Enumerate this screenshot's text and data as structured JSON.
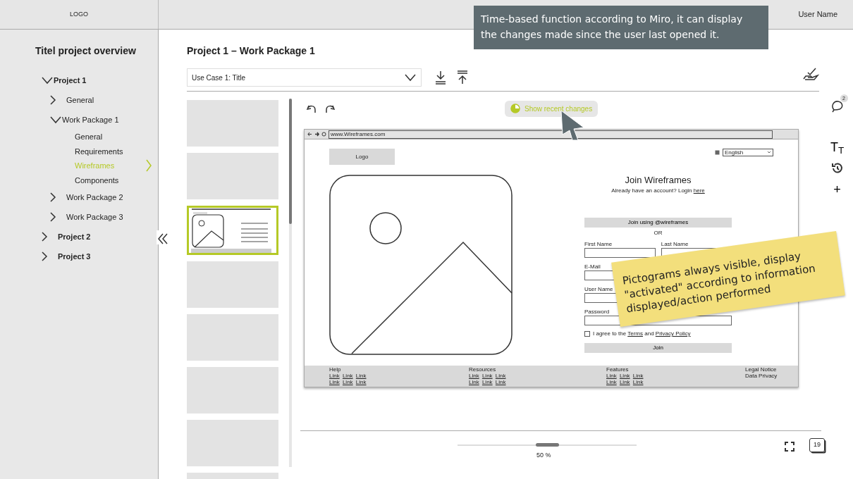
{
  "header": {
    "logo": "LOGO",
    "user_name": "User Name"
  },
  "notes": [
    {
      "kind": "tooltip",
      "text": "Time-based function according to Miro, it can display the changes made since the user last opened it."
    },
    {
      "kind": "sticky",
      "text": "Pictograms always visible, display \"activated\" according to information displayed/action performed"
    }
  ],
  "sidebar": {
    "title": "Titel project overview",
    "tree": [
      {
        "label": "Project 1",
        "expanded": true,
        "selected": false,
        "children": [
          {
            "label": "General",
            "expanded": false,
            "selected": false
          },
          {
            "label": "Work Package 1",
            "expanded": true,
            "selected": false,
            "children": [
              {
                "label": "General",
                "selected": false
              },
              {
                "label": "Requirements",
                "selected": false
              },
              {
                "label": "Wireframes",
                "selected": true
              },
              {
                "label": "Components",
                "selected": false
              }
            ]
          },
          {
            "label": "Work Package 2",
            "expanded": false,
            "selected": false
          },
          {
            "label": "Work Package 3",
            "expanded": false,
            "selected": false
          }
        ]
      },
      {
        "label": "Project 2",
        "expanded": false,
        "selected": false
      },
      {
        "label": "Project 3",
        "expanded": false,
        "selected": false
      }
    ]
  },
  "page_title": "Project 1 – Work Package 1",
  "use_case_select": {
    "value": "Use Case 1: Title"
  },
  "thumbnails": [
    {
      "selected": false
    },
    {
      "selected": false
    },
    {
      "selected": true
    },
    {
      "selected": false
    },
    {
      "selected": false
    },
    {
      "selected": false
    },
    {
      "selected": false
    },
    {
      "selected": false
    }
  ],
  "recent_changes_button": {
    "label": "Show recent changes"
  },
  "wireframe": {
    "url": "www.Wireframes.com",
    "logo": "Logo",
    "language": "English",
    "heading": "Join Wireframes",
    "login_prompt": "Already have an account? Login ",
    "login_link": "here",
    "social_button": "Join using @wireframes",
    "or": "OR",
    "form_rows": [
      [
        {
          "label": "First Name"
        },
        {
          "label": "Last Name"
        }
      ],
      [
        {
          "label": "E-Mail"
        }
      ],
      [
        {
          "label": "User Name"
        }
      ],
      [
        {
          "label": "Password"
        }
      ]
    ],
    "terms": {
      "checked": false,
      "text": "I agree to the ",
      "terms_link": "Terms",
      "and": " and ",
      "privacy_link": "Privacy Policy"
    },
    "submit": "Join",
    "footer": [
      {
        "title": "Help",
        "links": [
          "Link",
          "Link",
          "Link",
          "Link",
          "Link",
          "Link"
        ]
      },
      {
        "title": "Resources",
        "links": [
          "Link",
          "Link",
          "Link",
          "Link",
          "Link",
          "Link"
        ]
      },
      {
        "title": "Features",
        "links": [
          "Link",
          "Link",
          "Link",
          "Link",
          "Link",
          "Link"
        ]
      },
      {
        "links": [
          "Legal Notice",
          "Data Privacy"
        ]
      }
    ]
  },
  "side_tools": {
    "comment_count": "2",
    "text_size": "T$_{T}$",
    "add": "+"
  },
  "zoom": {
    "level": 0.5,
    "reading": "50 %"
  },
  "calendar_day": "19"
}
